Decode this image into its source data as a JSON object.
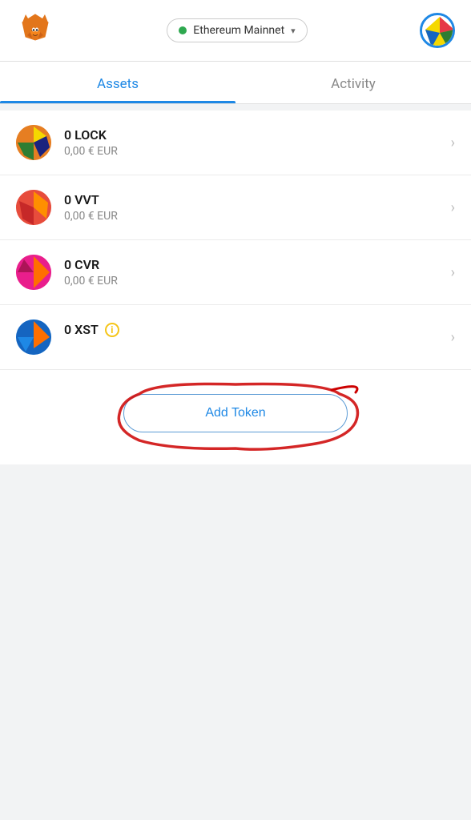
{
  "header": {
    "network_label": "Ethereum Mainnet",
    "network_status": "connected"
  },
  "tabs": {
    "assets_label": "Assets",
    "activity_label": "Activity",
    "active": "assets"
  },
  "assets": [
    {
      "id": "lock",
      "symbol": "LOCK",
      "amount": "0 LOCK",
      "value": "0,00 € EUR",
      "has_info": false
    },
    {
      "id": "vvt",
      "symbol": "VVT",
      "amount": "0 VVT",
      "value": "0,00 € EUR",
      "has_info": false
    },
    {
      "id": "cvr",
      "symbol": "CVR",
      "amount": "0 CVR",
      "value": "0,00 € EUR",
      "has_info": false
    },
    {
      "id": "xst",
      "symbol": "XST",
      "amount": "0 XST",
      "value": "",
      "has_info": true
    }
  ],
  "add_token": {
    "button_label": "Add Token"
  }
}
